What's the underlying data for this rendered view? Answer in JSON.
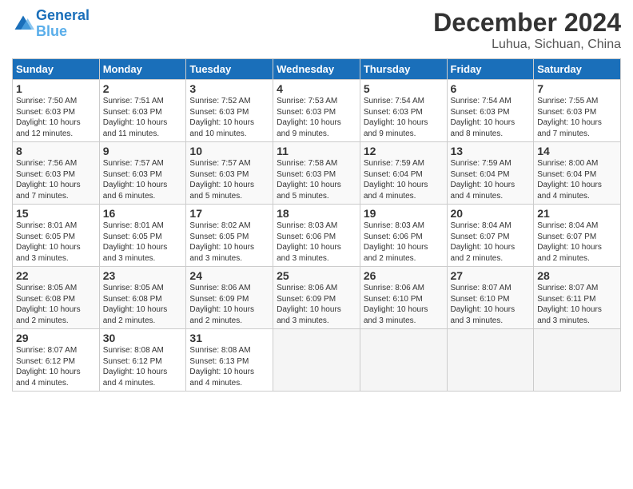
{
  "header": {
    "logo_line1": "General",
    "logo_line2": "Blue",
    "title": "December 2024",
    "subtitle": "Luhua, Sichuan, China"
  },
  "days_of_week": [
    "Sunday",
    "Monday",
    "Tuesday",
    "Wednesday",
    "Thursday",
    "Friday",
    "Saturday"
  ],
  "weeks": [
    [
      {
        "num": "1",
        "sunrise": "7:50 AM",
        "sunset": "6:03 PM",
        "daylight": "10 hours and 12 minutes."
      },
      {
        "num": "2",
        "sunrise": "7:51 AM",
        "sunset": "6:03 PM",
        "daylight": "10 hours and 11 minutes."
      },
      {
        "num": "3",
        "sunrise": "7:52 AM",
        "sunset": "6:03 PM",
        "daylight": "10 hours and 10 minutes."
      },
      {
        "num": "4",
        "sunrise": "7:53 AM",
        "sunset": "6:03 PM",
        "daylight": "10 hours and 9 minutes."
      },
      {
        "num": "5",
        "sunrise": "7:54 AM",
        "sunset": "6:03 PM",
        "daylight": "10 hours and 9 minutes."
      },
      {
        "num": "6",
        "sunrise": "7:54 AM",
        "sunset": "6:03 PM",
        "daylight": "10 hours and 8 minutes."
      },
      {
        "num": "7",
        "sunrise": "7:55 AM",
        "sunset": "6:03 PM",
        "daylight": "10 hours and 7 minutes."
      }
    ],
    [
      {
        "num": "8",
        "sunrise": "7:56 AM",
        "sunset": "6:03 PM",
        "daylight": "10 hours and 7 minutes."
      },
      {
        "num": "9",
        "sunrise": "7:57 AM",
        "sunset": "6:03 PM",
        "daylight": "10 hours and 6 minutes."
      },
      {
        "num": "10",
        "sunrise": "7:57 AM",
        "sunset": "6:03 PM",
        "daylight": "10 hours and 5 minutes."
      },
      {
        "num": "11",
        "sunrise": "7:58 AM",
        "sunset": "6:03 PM",
        "daylight": "10 hours and 5 minutes."
      },
      {
        "num": "12",
        "sunrise": "7:59 AM",
        "sunset": "6:04 PM",
        "daylight": "10 hours and 4 minutes."
      },
      {
        "num": "13",
        "sunrise": "7:59 AM",
        "sunset": "6:04 PM",
        "daylight": "10 hours and 4 minutes."
      },
      {
        "num": "14",
        "sunrise": "8:00 AM",
        "sunset": "6:04 PM",
        "daylight": "10 hours and 4 minutes."
      }
    ],
    [
      {
        "num": "15",
        "sunrise": "8:01 AM",
        "sunset": "6:05 PM",
        "daylight": "10 hours and 3 minutes."
      },
      {
        "num": "16",
        "sunrise": "8:01 AM",
        "sunset": "6:05 PM",
        "daylight": "10 hours and 3 minutes."
      },
      {
        "num": "17",
        "sunrise": "8:02 AM",
        "sunset": "6:05 PM",
        "daylight": "10 hours and 3 minutes."
      },
      {
        "num": "18",
        "sunrise": "8:03 AM",
        "sunset": "6:06 PM",
        "daylight": "10 hours and 3 minutes."
      },
      {
        "num": "19",
        "sunrise": "8:03 AM",
        "sunset": "6:06 PM",
        "daylight": "10 hours and 2 minutes."
      },
      {
        "num": "20",
        "sunrise": "8:04 AM",
        "sunset": "6:07 PM",
        "daylight": "10 hours and 2 minutes."
      },
      {
        "num": "21",
        "sunrise": "8:04 AM",
        "sunset": "6:07 PM",
        "daylight": "10 hours and 2 minutes."
      }
    ],
    [
      {
        "num": "22",
        "sunrise": "8:05 AM",
        "sunset": "6:08 PM",
        "daylight": "10 hours and 2 minutes."
      },
      {
        "num": "23",
        "sunrise": "8:05 AM",
        "sunset": "6:08 PM",
        "daylight": "10 hours and 2 minutes."
      },
      {
        "num": "24",
        "sunrise": "8:06 AM",
        "sunset": "6:09 PM",
        "daylight": "10 hours and 2 minutes."
      },
      {
        "num": "25",
        "sunrise": "8:06 AM",
        "sunset": "6:09 PM",
        "daylight": "10 hours and 3 minutes."
      },
      {
        "num": "26",
        "sunrise": "8:06 AM",
        "sunset": "6:10 PM",
        "daylight": "10 hours and 3 minutes."
      },
      {
        "num": "27",
        "sunrise": "8:07 AM",
        "sunset": "6:10 PM",
        "daylight": "10 hours and 3 minutes."
      },
      {
        "num": "28",
        "sunrise": "8:07 AM",
        "sunset": "6:11 PM",
        "daylight": "10 hours and 3 minutes."
      }
    ],
    [
      {
        "num": "29",
        "sunrise": "8:07 AM",
        "sunset": "6:12 PM",
        "daylight": "10 hours and 4 minutes."
      },
      {
        "num": "30",
        "sunrise": "8:08 AM",
        "sunset": "6:12 PM",
        "daylight": "10 hours and 4 minutes."
      },
      {
        "num": "31",
        "sunrise": "8:08 AM",
        "sunset": "6:13 PM",
        "daylight": "10 hours and 4 minutes."
      },
      null,
      null,
      null,
      null
    ]
  ]
}
